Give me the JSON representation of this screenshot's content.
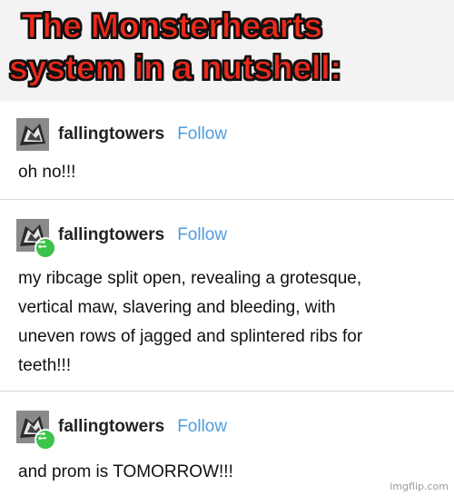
{
  "caption": {
    "line1": "The Monsterhearts",
    "line2": "system in a nutshell:"
  },
  "posts": [
    {
      "username": "fallingtowers",
      "follow_label": "Follow",
      "reblog": false,
      "lines": [
        "oh no!!!"
      ]
    },
    {
      "username": "fallingtowers",
      "follow_label": "Follow",
      "reblog": true,
      "lines": [
        "my ribcage split open, revealing a grotesque,",
        "vertical maw, slavering and bleeding, with",
        "uneven rows of jagged and splintered ribs for",
        "teeth!!!"
      ]
    },
    {
      "username": "fallingtowers",
      "follow_label": "Follow",
      "reblog": true,
      "lines": [
        "and prom is TOMORROW!!!"
      ]
    }
  ],
  "watermark": "imgflip.com",
  "colors": {
    "caption_fill": "#ee2a1b",
    "follow_link": "#4f9de0",
    "reblog_badge": "#3cc34a"
  }
}
